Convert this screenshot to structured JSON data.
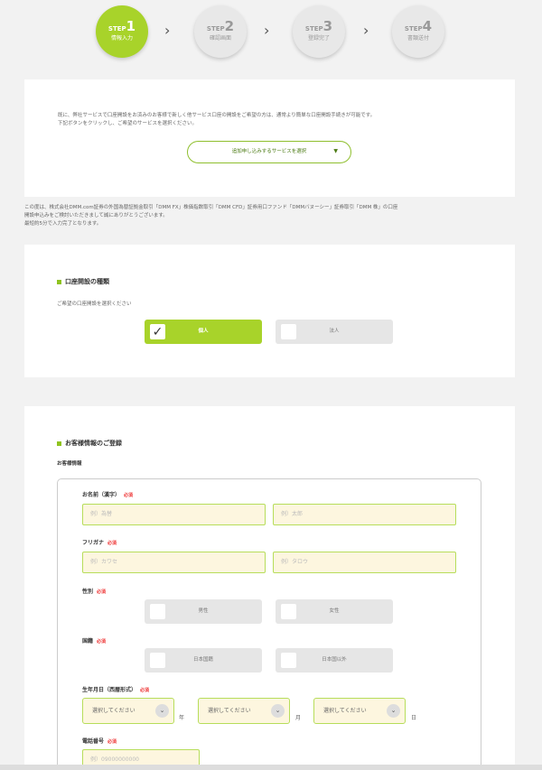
{
  "steps": [
    {
      "prefix": "STEP",
      "num": "1",
      "label": "情報入力"
    },
    {
      "prefix": "STEP",
      "num": "2",
      "label": "確認画面"
    },
    {
      "prefix": "STEP",
      "num": "3",
      "label": "登録完了"
    },
    {
      "prefix": "STEP",
      "num": "4",
      "label": "書類送付"
    }
  ],
  "chevron": "›",
  "intro": {
    "text1": "既に、弊社サービスで口座開設をお済みのお客様で新しく他サービス口座の開設をご希望の方は、通常より簡単な口座開設手続きが可能です。",
    "text2": "下記ボタンをクリックし、ご希望のサービスを選択ください。",
    "select_label": "追加申し込みするサービスを選択",
    "select_arrow": "▼"
  },
  "notice": {
    "line1": "この度は、株式会社DMM.com証券の外国為替証拠金取引「DMM FX」株価指数取引「DMM CFD」証券用口ファンド「DMMバヌーシー」証券取引「DMM 株」の口座",
    "line2": "開設申込みをご検討いただきまして誠にありがとうございます。",
    "line3": "最短約5分で入力完了となります。"
  },
  "account_type": {
    "title": "口座開設の種類",
    "hint": "ご希望の口座開設を選択ください",
    "options": [
      "個人",
      "法人"
    ],
    "check_mark": "✓"
  },
  "customer": {
    "title": "お客様情報のご登録",
    "subtitle": "お客様情報",
    "required": "必須",
    "name_label": "お名前（漢字）",
    "name_last_ph": "例）為替",
    "name_first_ph": "例）太郎",
    "kana_label": "フリガナ",
    "kana_last_ph": "例）カワセ",
    "kana_first_ph": "例）タロウ",
    "gender_label": "性別",
    "gender_options": [
      "男性",
      "女性"
    ],
    "nationality_label": "国籍",
    "nationality_options": [
      "日本国籍",
      "日本国以外"
    ],
    "birth_label": "生年月日（西暦形式）",
    "birth_select": "選択してください",
    "birth_units": [
      "年",
      "月",
      "日"
    ],
    "dd_arrow": "⌄",
    "phone_label": "電話番号",
    "phone_ph": "例）09000000000"
  }
}
